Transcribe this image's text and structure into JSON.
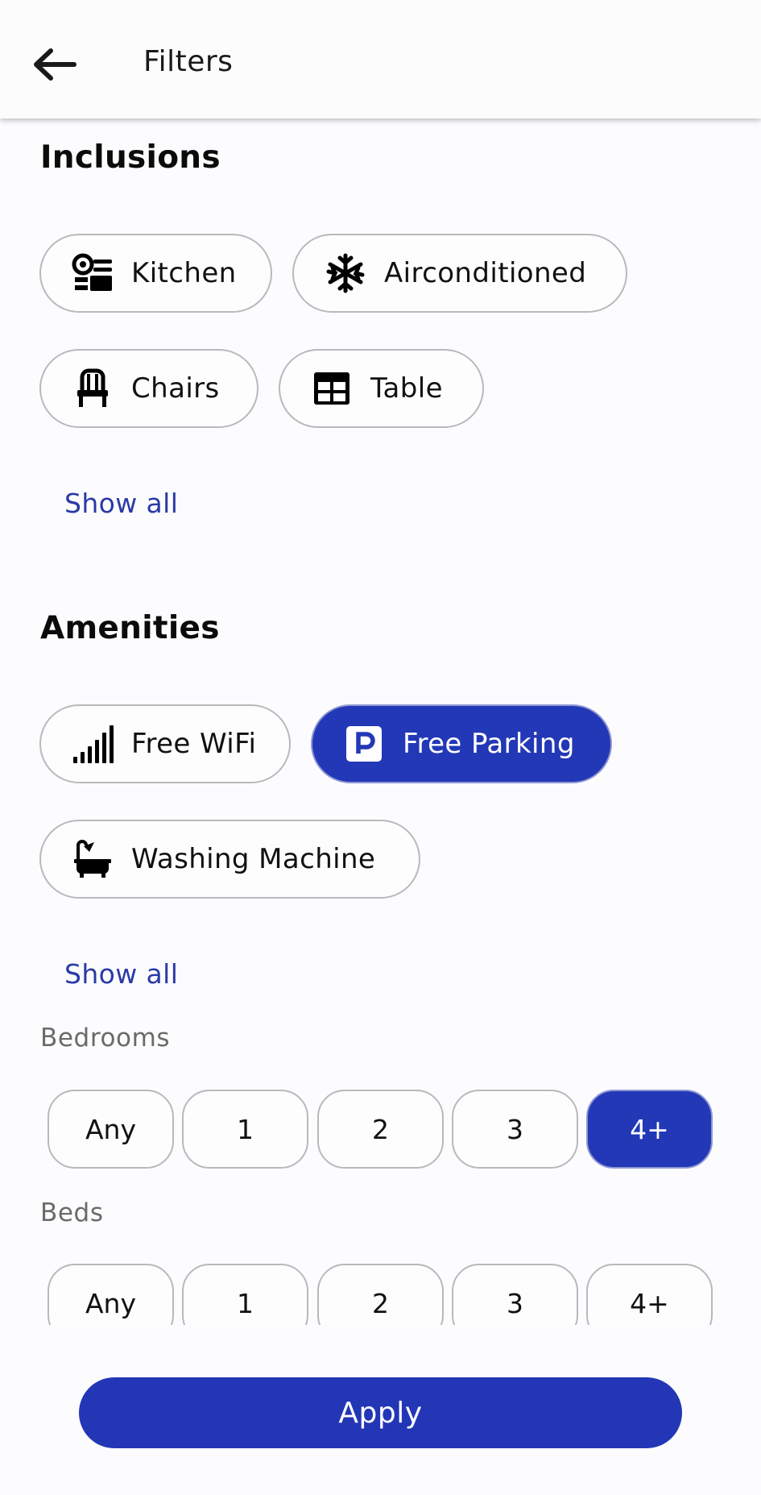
{
  "header": {
    "title": "Filters",
    "back_icon": "arrow-left-icon"
  },
  "inclusions": {
    "title": "Inclusions",
    "chips": [
      {
        "label": "Kitchen",
        "icon": "kitchen-icon",
        "selected": false
      },
      {
        "label": "Airconditioned",
        "icon": "snowflake-icon",
        "selected": false
      },
      {
        "label": "Chairs",
        "icon": "chair-icon",
        "selected": false
      },
      {
        "label": "Table",
        "icon": "table-icon",
        "selected": false
      }
    ],
    "show_all": "Show all"
  },
  "amenities": {
    "title": "Amenities",
    "chips": [
      {
        "label": "Free WiFi",
        "icon": "signal-icon",
        "selected": false
      },
      {
        "label": "Free Parking",
        "icon": "parking-icon",
        "selected": true
      },
      {
        "label": "Washing Machine",
        "icon": "bathtub-icon",
        "selected": false
      }
    ],
    "show_all": "Show all"
  },
  "bedrooms": {
    "title": "Bedrooms",
    "options": [
      "Any",
      "1",
      "2",
      "3",
      "4+"
    ],
    "selected": "4+"
  },
  "beds": {
    "title": "Beds",
    "options": [
      "Any",
      "1",
      "2",
      "3",
      "4+"
    ],
    "selected": ""
  },
  "apply_label": "Apply",
  "colors": {
    "accent": "#2338b6",
    "link": "#2a3aa6",
    "chip_border": "#b9b9bd"
  }
}
